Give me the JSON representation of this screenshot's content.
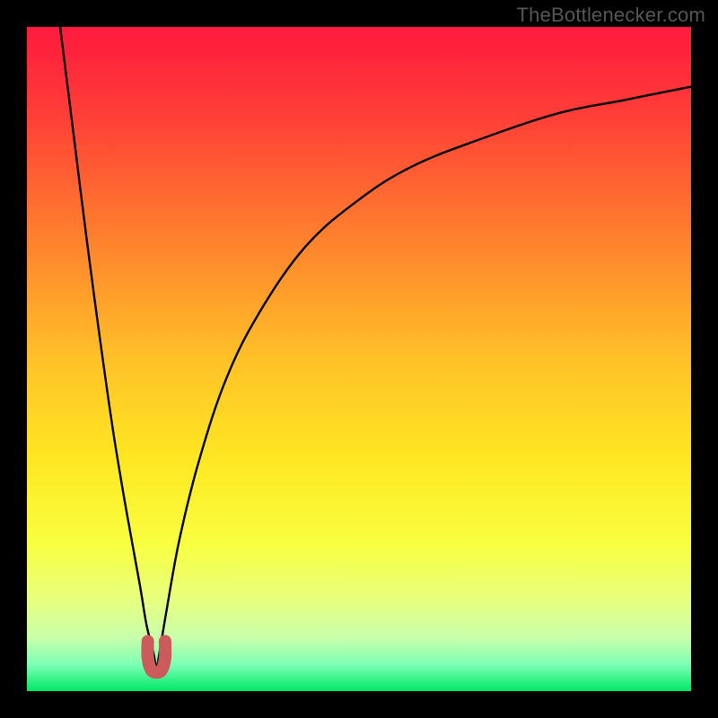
{
  "watermark": "TheBottlenecker.com",
  "chart_data": {
    "type": "line",
    "title": "",
    "xlabel": "",
    "ylabel": "",
    "xlim": [
      0,
      100
    ],
    "ylim": [
      0,
      100
    ],
    "gradient": {
      "stops": [
        {
          "pct": 0,
          "color": "#ff1a3e"
        },
        {
          "pct": 12,
          "color": "#ff3a38"
        },
        {
          "pct": 30,
          "color": "#ff7a2e"
        },
        {
          "pct": 50,
          "color": "#ffc128"
        },
        {
          "pct": 65,
          "color": "#ffe722"
        },
        {
          "pct": 78,
          "color": "#f8ff40"
        },
        {
          "pct": 86,
          "color": "#e8ff7d"
        },
        {
          "pct": 92,
          "color": "#c9ffab"
        },
        {
          "pct": 96,
          "color": "#7dffb6"
        },
        {
          "pct": 100,
          "color": "#00e865"
        }
      ]
    },
    "min_point": {
      "x": 19.5,
      "y": 3
    },
    "series": [
      {
        "name": "left-branch",
        "x": [
          5,
          7,
          9,
          11,
          13,
          15,
          17,
          18,
          19,
          19.5
        ],
        "y": [
          100,
          84,
          68,
          53,
          39,
          27,
          16,
          10,
          6,
          3
        ]
      },
      {
        "name": "right-branch",
        "x": [
          19.5,
          20,
          21,
          23,
          26,
          30,
          35,
          42,
          50,
          58,
          68,
          80,
          90,
          100
        ],
        "y": [
          3,
          6,
          12,
          23,
          35,
          47,
          57,
          67,
          74,
          79,
          83,
          87,
          89,
          91
        ]
      },
      {
        "name": "notch-marker",
        "x": [
          18.2,
          18.2,
          18.7,
          19.5,
          20.3,
          20.8,
          20.8
        ],
        "y": [
          7.5,
          5,
          3.2,
          2.8,
          3.2,
          5,
          7.5
        ]
      }
    ]
  }
}
